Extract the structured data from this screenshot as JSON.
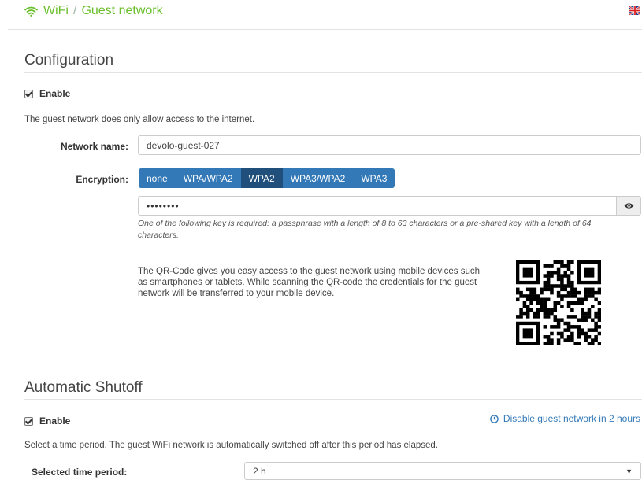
{
  "header": {
    "breadcrumb_root": "WiFi",
    "separator": "/",
    "breadcrumb_current": "Guest network",
    "language_icon": "uk-flag-icon",
    "accent_color": "#6bbf2d"
  },
  "configuration": {
    "title": "Configuration",
    "enable_label": "Enable",
    "enable_checked": true,
    "description": "The guest network does only allow access to the internet.",
    "network_name_label": "Network name:",
    "network_name_value": "devolo-guest-027",
    "encryption_label": "Encryption:",
    "encryption_options": [
      "none",
      "WPA/WPA2",
      "WPA2",
      "WPA3/WPA2",
      "WPA3"
    ],
    "encryption_selected": "WPA2",
    "password_value": "••••••••",
    "password_hint": "One of the following key is required: a passphrase with a length of 8 to 63 characters or a pre-shared key with a length of 64 characters.",
    "qr_description": "The QR-Code gives you easy access to the guest network using mobile devices such as smartphones or tablets. While scanning the QR-code the credentials for the guest network will be transferred to your mobile device."
  },
  "shutoff": {
    "title": "Automatic Shutoff",
    "enable_label": "Enable",
    "enable_checked": true,
    "disable_link": "Disable guest network in 2 hours",
    "description": "Select a time period. The guest WiFi network is automatically switched off after this period has elapsed.",
    "period_label": "Selected time period:",
    "period_value": "2 h"
  },
  "colors": {
    "primary": "#3479b7",
    "primary_active": "#1f4f7a"
  }
}
